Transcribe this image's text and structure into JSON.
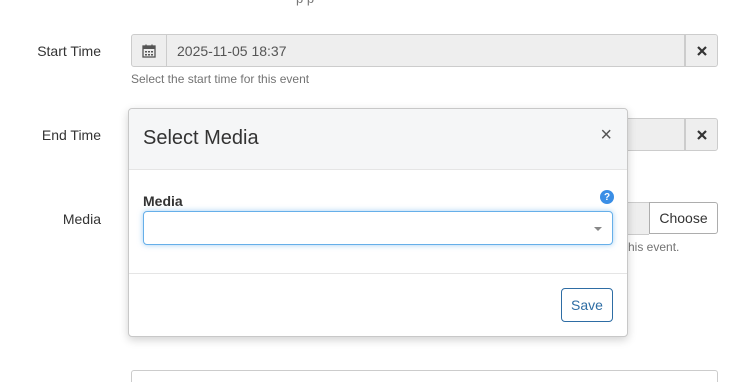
{
  "top_cut_text": "p     p",
  "form": {
    "start_time": {
      "label": "Start Time",
      "value": "2025-11-05 18:37",
      "help": "Select the start time for this event"
    },
    "end_time": {
      "label": "End Time"
    },
    "media": {
      "label": "Media",
      "choose_label": "Choose",
      "help_partial": "his event."
    }
  },
  "modal": {
    "title": "Select Media",
    "close_glyph": "×",
    "field_label": "Media",
    "help_glyph": "?",
    "select_value": "",
    "save_label": "Save"
  },
  "icons": {
    "calendar": "calendar-icon",
    "clear": "times-icon"
  },
  "colors": {
    "accent": "#2e6da4",
    "focus": "#66afe9",
    "help_icon": "#3a8ee6"
  }
}
